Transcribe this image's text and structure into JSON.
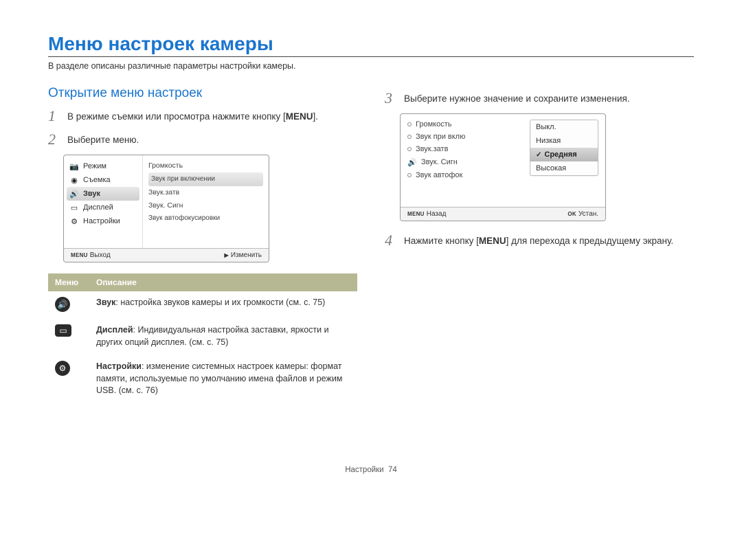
{
  "title": "Меню настроек камеры",
  "intro": "В разделе описаны различные параметры настройки камеры.",
  "left": {
    "section_title": "Открытие меню настроек",
    "step1_pre": "В режиме съемки или просмотра нажмите кнопку [",
    "step1_btn": "MENU",
    "step1_post": "].",
    "step2": "Выберите меню."
  },
  "screen1": {
    "left_items": {
      "mode": "Режим",
      "shoot": "Съемка",
      "sound": "Звук",
      "display": "Дисплей",
      "settings": "Настройки"
    },
    "right_items": {
      "vol": "Громкость",
      "pwr": "Звук при включении",
      "shutter": "Звук.затв",
      "beep": "Звук. Сигн",
      "af": "Звук автофокусировки"
    },
    "foot_left_key": "MENU",
    "foot_left": "Выход",
    "foot_right_key": "▶",
    "foot_right": "Изменить"
  },
  "table": {
    "hdr_menu": "Меню",
    "hdr_desc": "Описание",
    "row1_title": "Звук",
    "row1_body": ": настройка звуков камеры и их громкости (см. с. 75)",
    "row2_title": "Дисплей",
    "row2_body": ": Индивидуальная настройка заставки, яркости и других опций дисплея. (см. с. 75)",
    "row3_title": "Настройки",
    "row3_body": ": изменение системных настроек камеры: формат памяти, используемые по умолчанию имена файлов и режим USB. (см. с. 76)"
  },
  "right": {
    "step3": "Выберите нужное значение и сохраните изменения.",
    "step4_pre": "Нажмите кнопку [",
    "step4_btn": "MENU",
    "step4_post": "] для перехода к предыдущему экрану."
  },
  "screen2": {
    "list": {
      "vol": "Громкость",
      "pwr": "Звук при вклю",
      "shutter": "Звук.затв",
      "beep": "Звук. Сигн",
      "af": "Звук автофок"
    },
    "popup": {
      "off": "Выкл.",
      "low": "Низкая",
      "mid": "Средняя",
      "high": "Высокая"
    },
    "foot_left_key": "MENU",
    "foot_left": "Назад",
    "foot_right_key": "OK",
    "foot_right": "Устан."
  },
  "footer": {
    "section": "Настройки",
    "page": "74"
  }
}
